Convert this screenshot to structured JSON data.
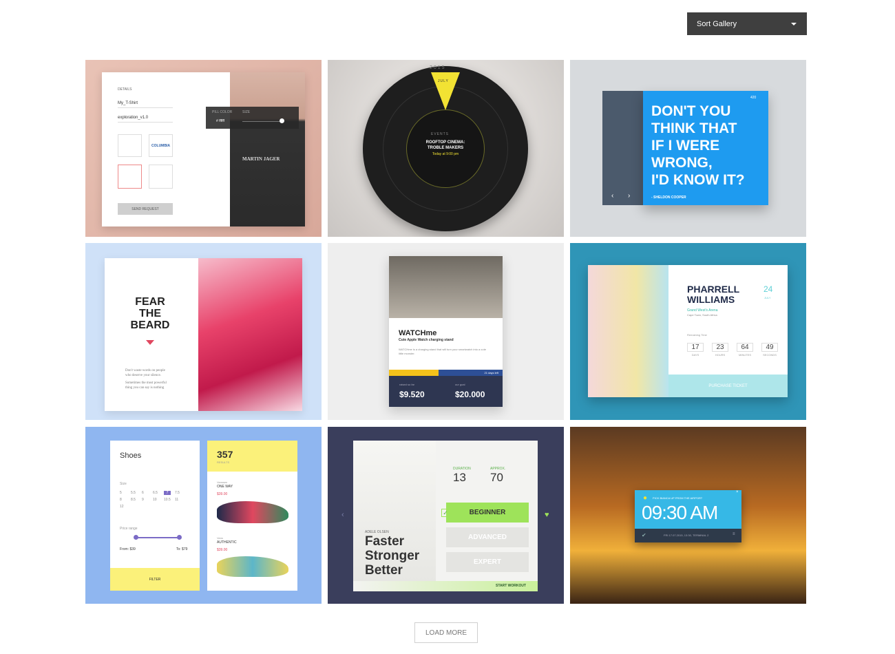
{
  "sort": {
    "label": "Sort Gallery"
  },
  "shirt": {
    "details": "DETAILS",
    "name": "My_T-Shirt",
    "file": "exploration_v1.0",
    "pill_color": "PILL COLOR",
    "size": "SIZE",
    "hex": "# ffffff",
    "send": "SEND REQUEST",
    "brand": "MARTIN JAGER",
    "logo2": "COLUMBIA"
  },
  "wheel": {
    "year": "2015",
    "month": "JULY",
    "events": "EVENTS",
    "title1": "ROOFTOP CINEMA:",
    "title2": "TROBLE MAKERS",
    "time": "Today at 9:00 pm"
  },
  "quote": {
    "likes": "420",
    "lines": [
      "DON'T YOU",
      "THINK THAT",
      "IF I WERE",
      "WRONG,",
      "I'D KNOW IT?"
    ],
    "author": "- SHELDON COOPER"
  },
  "beard": {
    "lines": [
      "FEAR",
      "THE",
      "BEARD"
    ],
    "copy1": "Don't waste words on people",
    "copy2": "who deserve your silence.",
    "copy3": "Sometimes the most powerful",
    "copy4": "thing you can say is nothing"
  },
  "watch": {
    "title": "WATCHme",
    "subtitle": "Cute Apple Watch charging stand",
    "desc": "WATCHme is a charging stand that will turn your smartwatch into a cute little monster.",
    "days": "21 days left",
    "raised_label": "raised so far",
    "raised": "$9.520",
    "goal_label": "our goal",
    "goal": "$20.000"
  },
  "concert": {
    "first": "PHARRELL",
    "last": "WILLIAMS",
    "day": "24",
    "month": "JULY",
    "venue": "Grand West's Arena",
    "city": "Cape Town, South Africa",
    "remaining": "Remaining Time",
    "counters": [
      {
        "value": "17",
        "unit": "DAYS"
      },
      {
        "value": "23",
        "unit": "HOURS"
      },
      {
        "value": "64",
        "unit": "MINUTES"
      },
      {
        "value": "49",
        "unit": "SECONDS"
      }
    ],
    "ticket": "PURCHASE TICKET"
  },
  "shoes": {
    "title": "Shoes",
    "size_label": "Size",
    "sizes": [
      "5",
      "5.5",
      "6",
      "6.5",
      "7",
      "7.5",
      "8",
      "8.5",
      "9",
      "10",
      "10.5",
      "11",
      "12"
    ],
    "selected_size": "7",
    "price_label": "Price range",
    "from": "From: $39",
    "to": "To: $79",
    "filter": "FILTER",
    "count": "357",
    "results": "RESULTS",
    "shoe1_brand": "Vanssen",
    "shoe1_name": "ONE WAY",
    "shoe1_price": "$39.00",
    "shoe2_brand": "Vans",
    "shoe2_name": "AUTHENTIC",
    "shoe2_price": "$39.00",
    "colors": {
      "accent": "#fbf17a",
      "purple": "#7b6bc6",
      "red": "#e0475f"
    }
  },
  "workout": {
    "duration_label": "DURATION",
    "duration": "13",
    "approx_label": "APPROX.",
    "approx": "70",
    "athlete": "ADELE OLSEN",
    "headline": [
      "Faster",
      "Stronger",
      "Better"
    ],
    "levels": [
      "BEGINNER",
      "ADVANCED",
      "EXPERT"
    ],
    "start": "START WORKOUT",
    "accent": "#9ee35a"
  },
  "alarm": {
    "note": "PICK BIANCA UP FROM THE AIRPORT",
    "time": "09:30 AM",
    "detail": "FRI 17.07.2015, 13:30, TERMINAL 2"
  },
  "load_more": "LOAD MORE"
}
